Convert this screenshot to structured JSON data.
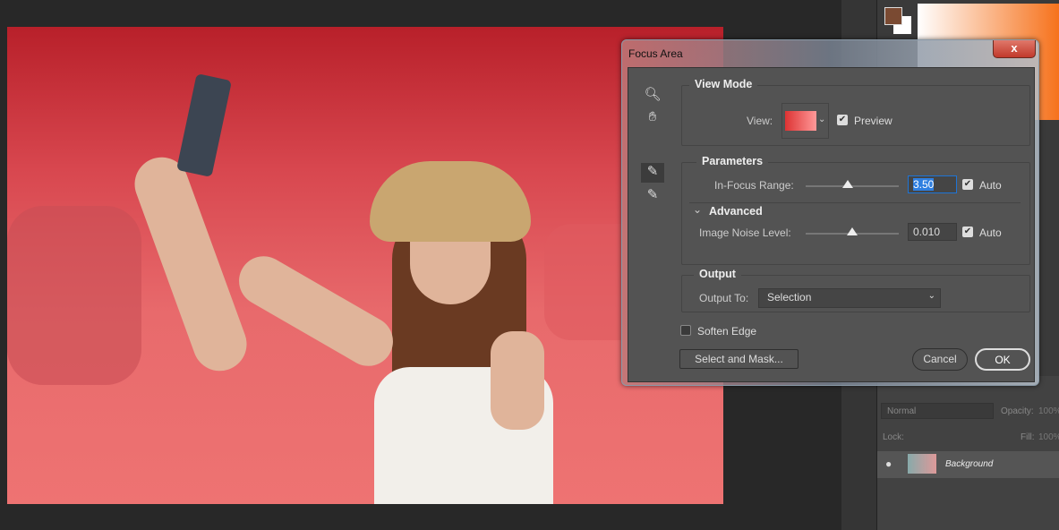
{
  "dialog": {
    "title": "Focus Area",
    "close_label": "x",
    "view_mode": {
      "heading": "View Mode",
      "view_label": "View:",
      "preview_label": "Preview",
      "preview_checked": true
    },
    "parameters": {
      "heading": "Parameters",
      "in_focus_label": "In-Focus Range:",
      "in_focus_value": "3.50",
      "in_focus_auto_label": "Auto",
      "in_focus_auto": true,
      "in_focus_slider": 0.45,
      "advanced_heading": "Advanced",
      "noise_label": "Image Noise Level:",
      "noise_value": "0.010",
      "noise_auto_label": "Auto",
      "noise_auto": true,
      "noise_slider": 0.5
    },
    "output": {
      "heading": "Output",
      "output_to_label": "Output To:",
      "output_to_value": "Selection"
    },
    "soften_edge_label": "Soften Edge",
    "soften_edge_checked": false,
    "select_mask_label": "Select and Mask...",
    "cancel_label": "Cancel",
    "ok_label": "OK"
  },
  "layers": {
    "blend_mode": "Normal",
    "opacity_label": "Opacity:",
    "opacity_value": "100%",
    "lock_label": "Lock:",
    "fill_label": "Fill:",
    "fill_value": "100%",
    "layer_name": "Background"
  },
  "colors": {
    "foreground": "#7a4a32",
    "background": "#ffffff",
    "overlay": "#e0505a"
  }
}
